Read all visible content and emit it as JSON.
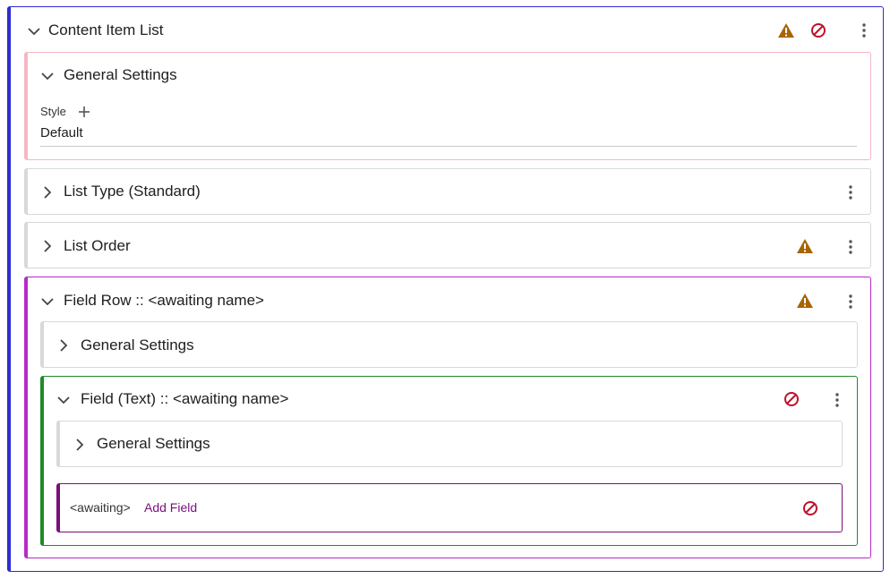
{
  "root": {
    "title": "Content Item List"
  },
  "general_settings": {
    "title": "General Settings",
    "style_label": "Style",
    "style_value": "Default"
  },
  "list_type": {
    "title": "List Type (Standard)"
  },
  "list_order": {
    "title": "List Order"
  },
  "field_row": {
    "title": "Field Row :: <awaiting name>",
    "general_settings_title": "General Settings",
    "field_text": {
      "title": "Field (Text) :: <awaiting name>",
      "general_settings_title": "General Settings",
      "add_field": {
        "placeholder": "<awaiting>",
        "link_label": "Add Field"
      }
    }
  },
  "icons": {
    "warning": "warning-icon",
    "blocked": "blocked-icon",
    "more": "more-vert-icon",
    "expand": "chevron-down-icon",
    "collapse": "chevron-right-icon",
    "add": "plus-icon"
  },
  "colors": {
    "root_accent": "#2b2bd6",
    "general_accent": "#f4b8c4",
    "field_row_accent": "#b52cc6",
    "field_text_accent": "#1f8a2a",
    "add_field_accent": "#7a0f7a",
    "warning": "#a86400",
    "blocked": "#c0102a"
  }
}
